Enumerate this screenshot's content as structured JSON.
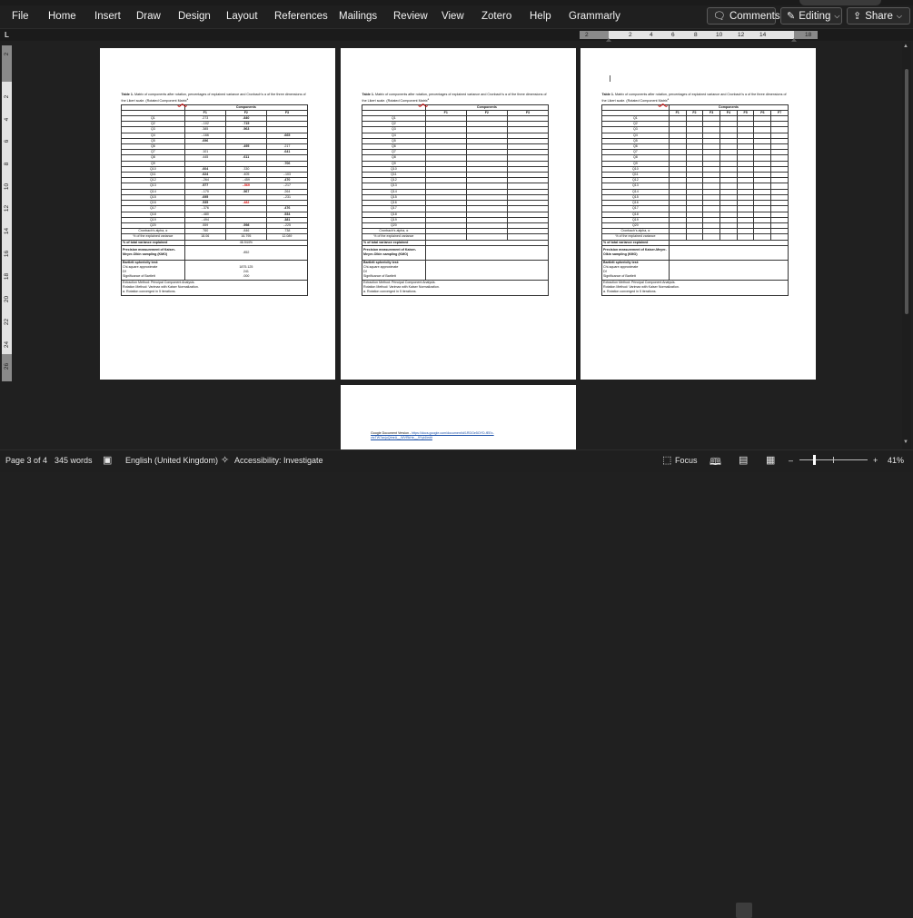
{
  "ribbon": {
    "tabs": [
      "File",
      "Home",
      "Insert",
      "Draw",
      "Design",
      "Layout",
      "References",
      "Mailings",
      "Review",
      "View",
      "Zotero",
      "Help",
      "Grammarly"
    ],
    "comments_label": "Comments",
    "editing_label": "Editing",
    "share_label": "Share"
  },
  "ruler": {
    "corner": "L",
    "h_numbers": [
      "2",
      "2",
      "4",
      "6",
      "8",
      "10",
      "12",
      "14",
      "18"
    ],
    "v_numbers": [
      "2",
      "2",
      "4",
      "6",
      "8",
      "10",
      "12",
      "14",
      "16",
      "18",
      "20",
      "22",
      "24",
      "26"
    ]
  },
  "document": {
    "caption_bold": "Table 1.",
    "caption_rest": " Matrix of components after rotation, percentages of explained variance and Cronbach's α of the three dimensions of the Likert scale. (Rotated Component ",
    "caption_tail": "Matrix",
    "caption_end": "a",
    "components_header": "Components",
    "columns_3": [
      "F1",
      "F2",
      "F3"
    ],
    "columns_7": [
      "F1",
      "F2",
      "F3",
      "F4",
      "F5",
      "F6",
      "F7"
    ],
    "rows": [
      {
        "label": "Q1",
        "f1": ".273",
        "f2": ".840",
        "f3": "",
        "f2b": true
      },
      {
        "label": "Q2",
        "f1": "-.102",
        "f2": ".715",
        "f3": "",
        "f2b": true
      },
      {
        "label": "Q3",
        "f1": ".385",
        "f2": ".563",
        "f3": "",
        "f2b": true
      },
      {
        "label": "Q4",
        "f1": "-.166",
        "f2": "",
        "f3": ".665",
        "f3b": true
      },
      {
        "label": "Q5",
        "f1": ".696",
        "f2": "",
        "f3": "",
        "f1b": true
      },
      {
        "label": "Q6",
        "f1": "",
        "f2": ".495",
        "f3": ".217",
        "f2b": true
      },
      {
        "label": "Q7",
        "f1": ".101",
        "f2": "",
        "f3": ".641",
        "f3b": true
      },
      {
        "label": "Q8",
        "f1": ".445",
        "f2": ".611",
        "f3": "",
        "f2b": true
      },
      {
        "label": "Q9",
        "f1": "",
        "f2": "",
        "f3": ".706",
        "f3b": true
      },
      {
        "label": "Q10",
        "f1": ".604",
        "f2": ".330",
        "f3": "",
        "f1b": true
      },
      {
        "label": "Q11",
        "f1": ".624",
        "f2": ".405",
        "f3": "-.103",
        "f1b": true
      },
      {
        "label": "Q12",
        "f1": "-.264",
        "f2": "-.459",
        "f3": ".470",
        "f3b": true
      },
      {
        "label": "Q13",
        "f1": ".577",
        "f2": "-.569",
        "f3": "-.217",
        "f1b": true,
        "f2red": true
      },
      {
        "label": "Q14",
        "f1": "-.170",
        "f2": ".567",
        "f3": ".264",
        "f2b": true
      },
      {
        "label": "Q15",
        "f1": ".695",
        "f2": "",
        "f3": "-.231",
        "f1b": true
      },
      {
        "label": "Q16",
        "f1": ".535",
        "f2": ".482",
        "f3": "",
        "f1b": true,
        "f2red": true
      },
      {
        "label": "Q17",
        "f1": "-.376",
        "f2": "",
        "f3": ".476",
        "f3b": true
      },
      {
        "label": "Q18",
        "f1": "-.480",
        "f2": "",
        "f3": ".534",
        "f3b": true
      },
      {
        "label": "Q19",
        "f1": "-.494",
        "f2": "",
        "f3": ".381",
        "f3b": true
      },
      {
        "label": "Q20",
        "f1": ".559",
        "f2": ".598",
        "f3": "-.225",
        "f2b": true
      }
    ],
    "cronbach": {
      "label": "Cronbach's alpha, α",
      "f1": ".760",
      "f2": ".846",
      "f3": ".738"
    },
    "pct_variance": {
      "label": "% of the explained variance",
      "f1": "18.06",
      "f2": "16.795",
      "f3": "12.089"
    },
    "pct_total": {
      "label": "% of total variance explained",
      "value": "46.944%"
    },
    "kmo": {
      "label": "Precision measurement of Kaiser-Meyer-Olkin sampling (KMO)",
      "value": ".852"
    },
    "bartlett": {
      "label": "Bartlett sphericity test:",
      "lines": [
        "Chi-square approximate",
        "Df",
        "Significance of Bartlett"
      ],
      "values": [
        "1875.125",
        "241",
        ".000"
      ]
    },
    "notes": [
      "Extraction Method: Principal Component Analysis.",
      "Rotation Method: Varimax with Kaiser Normalization.",
      "a. Rotation converged in 5 iterations."
    ],
    "footer_line1_prefix": "Google Document Version - ",
    "footer_link": "https://docs.google.com/document/d/1RDGe5OYD-fEEx-",
    "footer_line2": "ztcTW7avjuQtmrA__WVRkHe__9Yyt4/edit"
  },
  "status": {
    "page": "Page 3 of 4",
    "words": "345 words",
    "language": "English (United Kingdom)",
    "accessibility": "Accessibility: Investigate",
    "focus": "Focus",
    "zoom": "41%"
  },
  "colors": {
    "accent_red": "#d00000",
    "link_blue": "#1a4fa8",
    "ribbon_bg": "#1f1f1f",
    "canvas_bg": "#202020"
  },
  "icons": [
    "comment-icon",
    "pencil-icon",
    "share-icon",
    "proofing-icon",
    "accessibility-icon",
    "focus-icon",
    "read-mode-icon",
    "print-layout-icon",
    "web-layout-icon"
  ]
}
